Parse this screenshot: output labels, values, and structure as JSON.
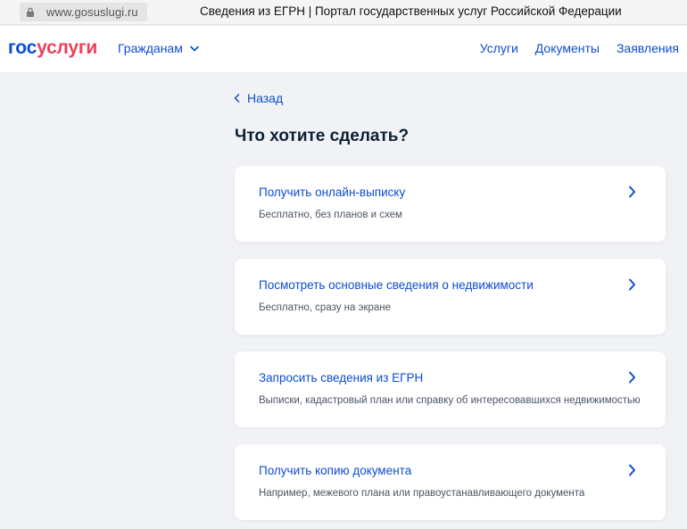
{
  "browser": {
    "url": "www.gosuslugi.ru",
    "tab_title": "Сведения из ЕГРН | Портал государственных услуг Российской Федерации"
  },
  "header": {
    "logo_part1": "гос",
    "logo_part2": "услуги",
    "audience_label": "Гражданам",
    "nav": [
      "Услуги",
      "Документы",
      "Заявления"
    ],
    "colors": {
      "brand_blue": "#0d4cd3",
      "brand_red": "#ee3f58"
    }
  },
  "main": {
    "back_label": "Назад",
    "title": "Что хотите сделать?",
    "options": [
      {
        "title": "Получить онлайн-выписку",
        "description": "Бесплатно, без планов и схем"
      },
      {
        "title": "Посмотреть основные сведения о недвижимости",
        "description": "Бесплатно, сразу на экране"
      },
      {
        "title": "Запросить сведения из ЕГРН",
        "description": "Выписки, кадастровый план или справку об интересовавшихся недвижимостью"
      },
      {
        "title": "Получить копию документа",
        "description": "Например, межевого плана или правоустанавливающего документа"
      }
    ]
  },
  "icons": {
    "lock": "lock-icon",
    "dropdown": "chevron-down-icon",
    "back": "chevron-left-icon",
    "option_arrow": "chevron-right-icon"
  }
}
